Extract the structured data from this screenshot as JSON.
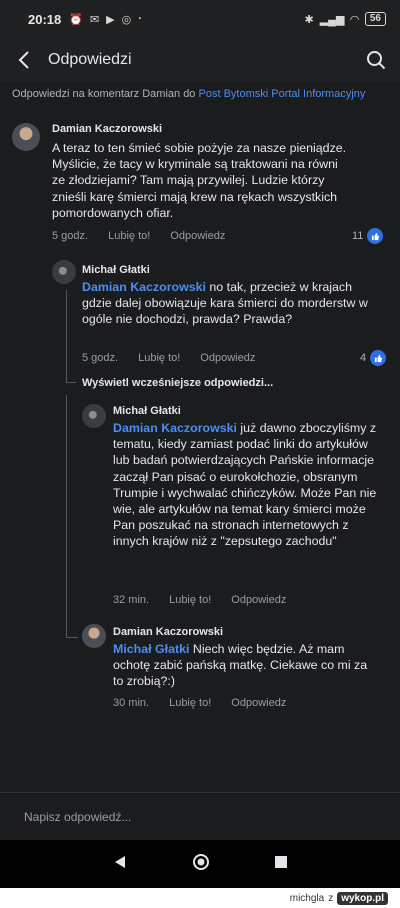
{
  "status_bar": {
    "time": "20:18",
    "battery": "56"
  },
  "header": {
    "title": "Odpowiedzi"
  },
  "context": {
    "prefix": "Odpowiedzi na komentarz Damian do",
    "post_link": "Post Bytomski Portal Informacyjny"
  },
  "comments": [
    {
      "author": "Damian Kaczorowski",
      "mention": "",
      "text": "A teraz to ten śmieć sobie pożyje za nasze pieniądze. Myślicie, że tacy w kryminale są traktowani na równi ze złodziejami? Tam mają przywilej. Ludzie którzy znieśli karę śmierci mają krew na rękach wszystkich pomordowanych ofiar.",
      "time": "5 godz.",
      "like": "Lubię to!",
      "reply": "Odpowiedz",
      "likes": "11"
    },
    {
      "author": "Michał Głatki",
      "mention": "Damian Kaczorowski",
      "text": "no tak, przecież w krajach gdzie dalej obowiązuje kara śmierci do morderstw w ogóle nie dochodzi, prawda? Prawda?",
      "time": "5 godz.",
      "like": "Lubię to!",
      "reply": "Odpowiedz",
      "likes": "4"
    },
    {
      "author": "Michał Głatki",
      "mention": "Damian Kaczorowski",
      "text": "już dawno zboczyliśmy z tematu, kiedy zamiast podać linki do artykułów lub badań potwierdzających Pańskie informacje zaczął Pan pisać o eurokołchozie, obsranym Trumpie i wychwalać chińczyków. Może Pan nie wie, ale artykułów na temat kary śmierci może Pan poszukać na stronach internetowych z innych krajów niż z \"zepsutego zachodu\"",
      "time": "32 min.",
      "like": "Lubię to!",
      "reply": "Odpowiedz",
      "likes": ""
    },
    {
      "author": "Damian Kaczorowski",
      "mention": "Michał Głatki",
      "text": "Niech więc będzie. Aż mam ochotę zabić pańską matkę. Ciekawe co mi za to zrobią?:)",
      "time": "30 min.",
      "like": "Lubię to!",
      "reply": "Odpowiedz",
      "likes": ""
    }
  ],
  "view_earlier": "Wyświetl wcześniejsze odpowiedzi...",
  "composer": {
    "placeholder": "Napisz odpowiedź..."
  },
  "footer": {
    "user": "michgla",
    "sep": "z",
    "site": "wykop.pl"
  },
  "colors": {
    "background": "#1b1c1e",
    "link": "#4a8ff0",
    "like_badge": "#2e6fe3"
  },
  "icons": [
    "back-arrow-icon",
    "search-icon",
    "like-icon",
    "nav-back-icon",
    "nav-home-icon",
    "nav-recents-icon"
  ]
}
